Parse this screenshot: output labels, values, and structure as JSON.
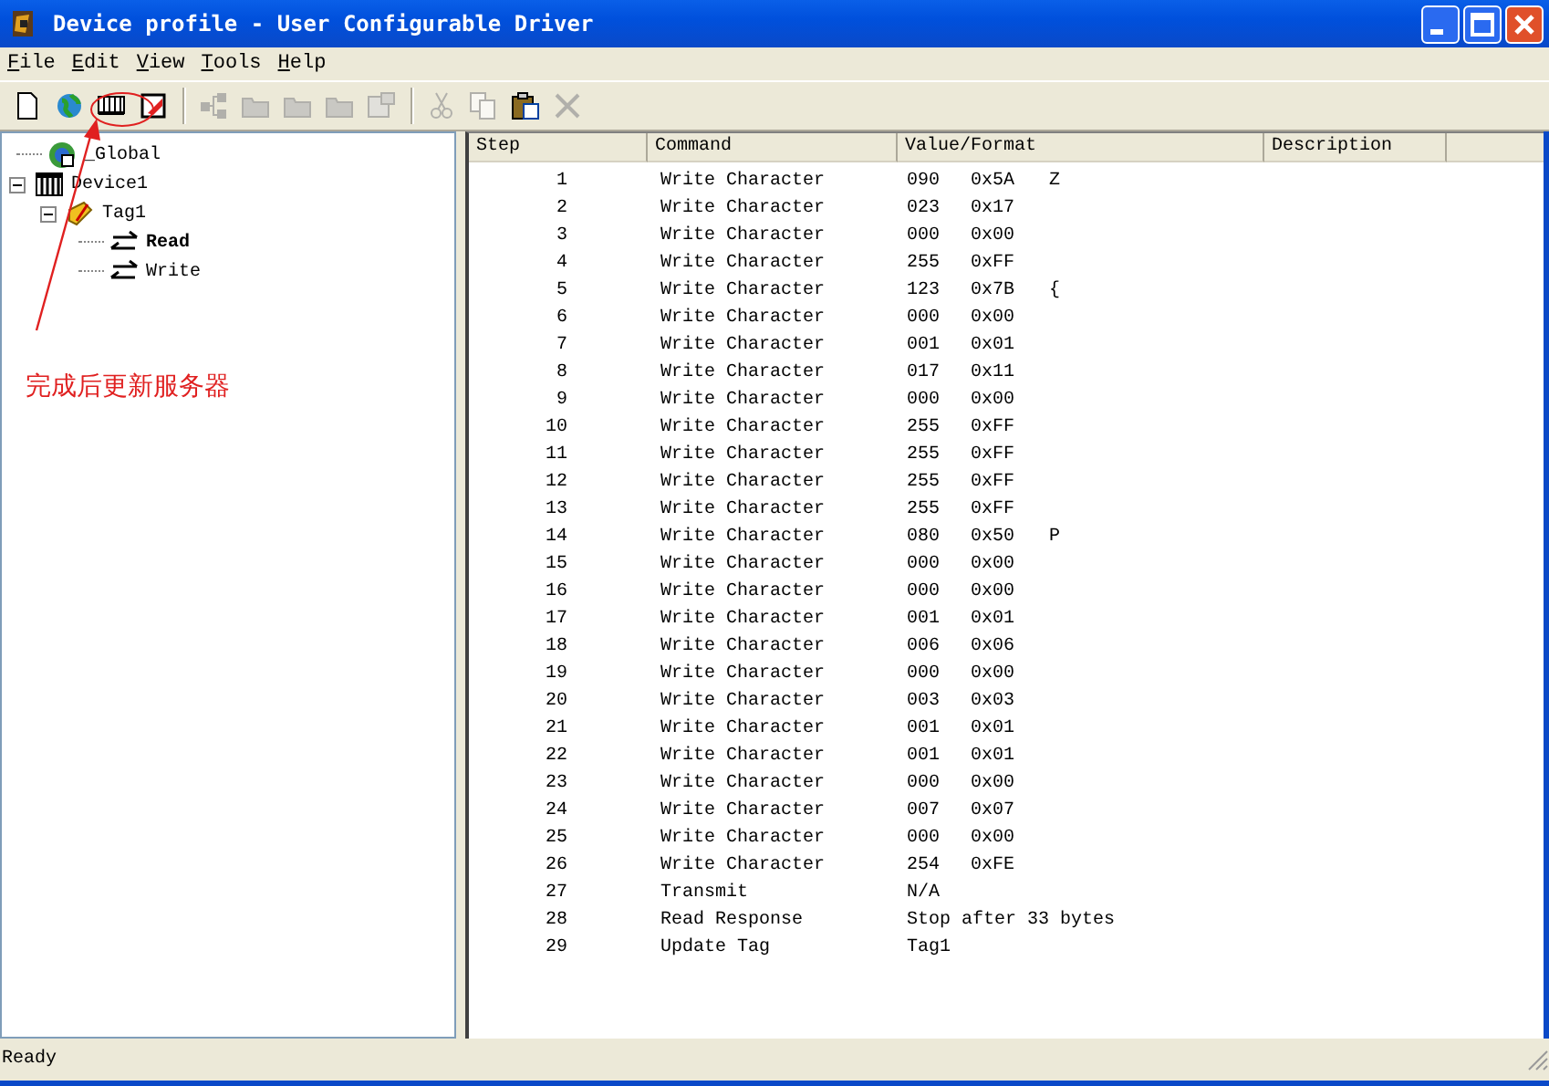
{
  "window": {
    "title": "Device profile - User Configurable Driver"
  },
  "menu": [
    {
      "label": "File"
    },
    {
      "label": "Edit"
    },
    {
      "label": "View"
    },
    {
      "label": "Tools"
    },
    {
      "label": "Help"
    }
  ],
  "toolbar": [
    {
      "kind": "new",
      "disabled": false
    },
    {
      "kind": "globe",
      "disabled": false
    },
    {
      "kind": "device",
      "disabled": false
    },
    {
      "kind": "check",
      "disabled": false
    },
    {
      "kind": "sep"
    },
    {
      "kind": "tree",
      "disabled": true
    },
    {
      "kind": "folder",
      "disabled": true
    },
    {
      "kind": "folder",
      "disabled": true
    },
    {
      "kind": "folder",
      "disabled": true
    },
    {
      "kind": "props",
      "disabled": true
    },
    {
      "kind": "sep"
    },
    {
      "kind": "cut",
      "disabled": true
    },
    {
      "kind": "copy",
      "disabled": true
    },
    {
      "kind": "paste",
      "disabled": false
    },
    {
      "kind": "delete",
      "disabled": true
    }
  ],
  "tree": [
    {
      "label": "_Global",
      "kind": "globe",
      "selected": false
    },
    {
      "label": "Device1",
      "kind": "device",
      "expanded": true,
      "selected": false,
      "children": [
        {
          "label": "Tag1",
          "kind": "tag",
          "expanded": true,
          "selected": false,
          "children": [
            {
              "label": "Read",
              "kind": "transfer",
              "selected": true
            },
            {
              "label": "Write",
              "kind": "transfer",
              "selected": false
            }
          ]
        }
      ]
    }
  ],
  "table": {
    "columns": [
      "Step",
      "Command",
      "Value/Format",
      "Description"
    ],
    "rows": [
      {
        "step": "1",
        "command": "Write Character",
        "value": "090",
        "hex": "0x5A",
        "char": "Z"
      },
      {
        "step": "2",
        "command": "Write Character",
        "value": "023",
        "hex": "0x17"
      },
      {
        "step": "3",
        "command": "Write Character",
        "value": "000",
        "hex": "0x00"
      },
      {
        "step": "4",
        "command": "Write Character",
        "value": "255",
        "hex": "0xFF"
      },
      {
        "step": "5",
        "command": "Write Character",
        "value": "123",
        "hex": "0x7B",
        "char": "{"
      },
      {
        "step": "6",
        "command": "Write Character",
        "value": "000",
        "hex": "0x00"
      },
      {
        "step": "7",
        "command": "Write Character",
        "value": "001",
        "hex": "0x01"
      },
      {
        "step": "8",
        "command": "Write Character",
        "value": "017",
        "hex": "0x11"
      },
      {
        "step": "9",
        "command": "Write Character",
        "value": "000",
        "hex": "0x00"
      },
      {
        "step": "10",
        "command": "Write Character",
        "value": "255",
        "hex": "0xFF"
      },
      {
        "step": "11",
        "command": "Write Character",
        "value": "255",
        "hex": "0xFF"
      },
      {
        "step": "12",
        "command": "Write Character",
        "value": "255",
        "hex": "0xFF"
      },
      {
        "step": "13",
        "command": "Write Character",
        "value": "255",
        "hex": "0xFF"
      },
      {
        "step": "14",
        "command": "Write Character",
        "value": "080",
        "hex": "0x50",
        "char": "P"
      },
      {
        "step": "15",
        "command": "Write Character",
        "value": "000",
        "hex": "0x00"
      },
      {
        "step": "16",
        "command": "Write Character",
        "value": "000",
        "hex": "0x00"
      },
      {
        "step": "17",
        "command": "Write Character",
        "value": "001",
        "hex": "0x01"
      },
      {
        "step": "18",
        "command": "Write Character",
        "value": "006",
        "hex": "0x06"
      },
      {
        "step": "19",
        "command": "Write Character",
        "value": "000",
        "hex": "0x00"
      },
      {
        "step": "20",
        "command": "Write Character",
        "value": "003",
        "hex": "0x03"
      },
      {
        "step": "21",
        "command": "Write Character",
        "value": "001",
        "hex": "0x01"
      },
      {
        "step": "22",
        "command": "Write Character",
        "value": "001",
        "hex": "0x01"
      },
      {
        "step": "23",
        "command": "Write Character",
        "value": "000",
        "hex": "0x00"
      },
      {
        "step": "24",
        "command": "Write Character",
        "value": "007",
        "hex": "0x07"
      },
      {
        "step": "25",
        "command": "Write Character",
        "value": "000",
        "hex": "0x00"
      },
      {
        "step": "26",
        "command": "Write Character",
        "value": "254",
        "hex": "0xFE"
      },
      {
        "step": "27",
        "command": "Transmit",
        "value": "N/A"
      },
      {
        "step": "28",
        "command": "Read Response",
        "value": "Stop after 33 bytes"
      },
      {
        "step": "29",
        "command": "Update Tag",
        "value": "Tag1"
      }
    ]
  },
  "annotation": {
    "text": "完成后更新服务器"
  },
  "status_bar": {
    "text": "Ready"
  }
}
